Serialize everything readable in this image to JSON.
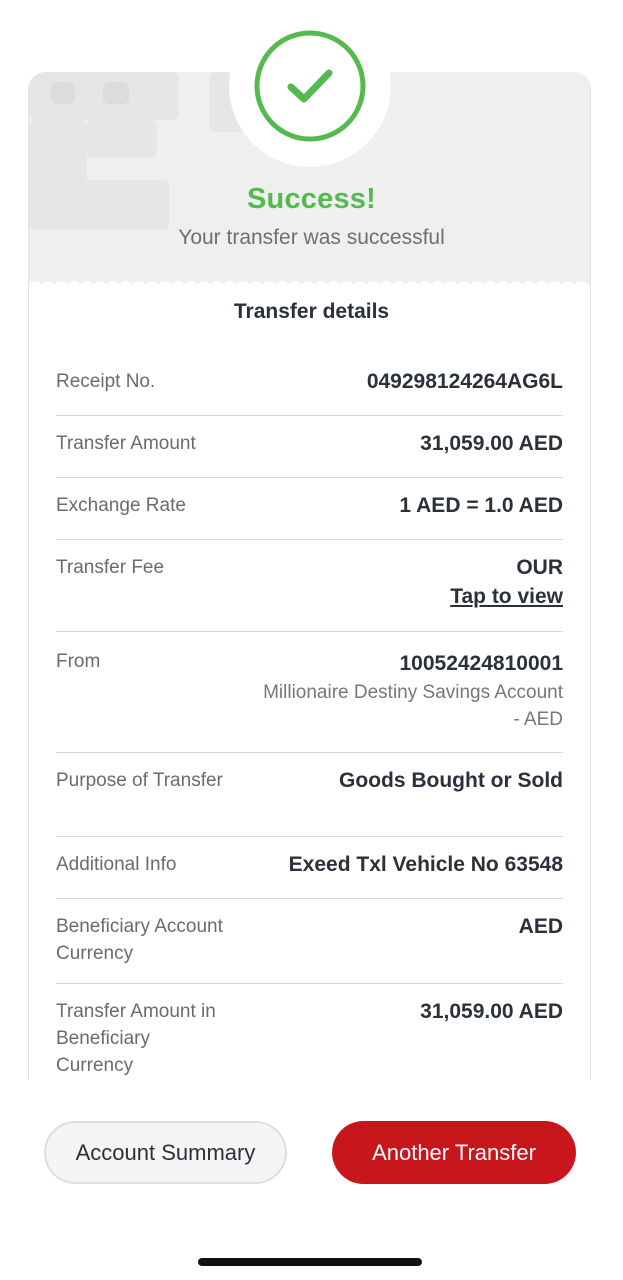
{
  "status": {
    "title": "Success!",
    "subtitle": "Your transfer was successful",
    "accent_color": "#54b94f",
    "icon": "check-icon"
  },
  "details": {
    "title": "Transfer details",
    "rows": [
      {
        "label": "Receipt No.",
        "value": "049298124264AG6L"
      },
      {
        "label": "Transfer Amount",
        "value": "31,059.00 AED"
      },
      {
        "label": "Exchange Rate",
        "value": "1 AED = 1.0 AED"
      },
      {
        "label": "Transfer Fee",
        "value": "OUR",
        "link": "Tap to view"
      },
      {
        "label": "From",
        "value": "10052424810001",
        "sub": "Millionaire Destiny Savings Account - AED"
      },
      {
        "label": "Purpose of Transfer",
        "value": "Goods Bought or Sold"
      },
      {
        "label": "Additional Info",
        "value": "Exeed Txl Vehicle No 63548"
      },
      {
        "label": "Beneficiary Account Currency",
        "value": "AED"
      },
      {
        "label": "Transfer Amount in Beneficiary Currency",
        "value": "31,059.00 AED"
      }
    ]
  },
  "actions": {
    "account_summary_label": "Account Summary",
    "another_transfer_label": "Another Transfer",
    "primary_color": "#c8161d"
  }
}
